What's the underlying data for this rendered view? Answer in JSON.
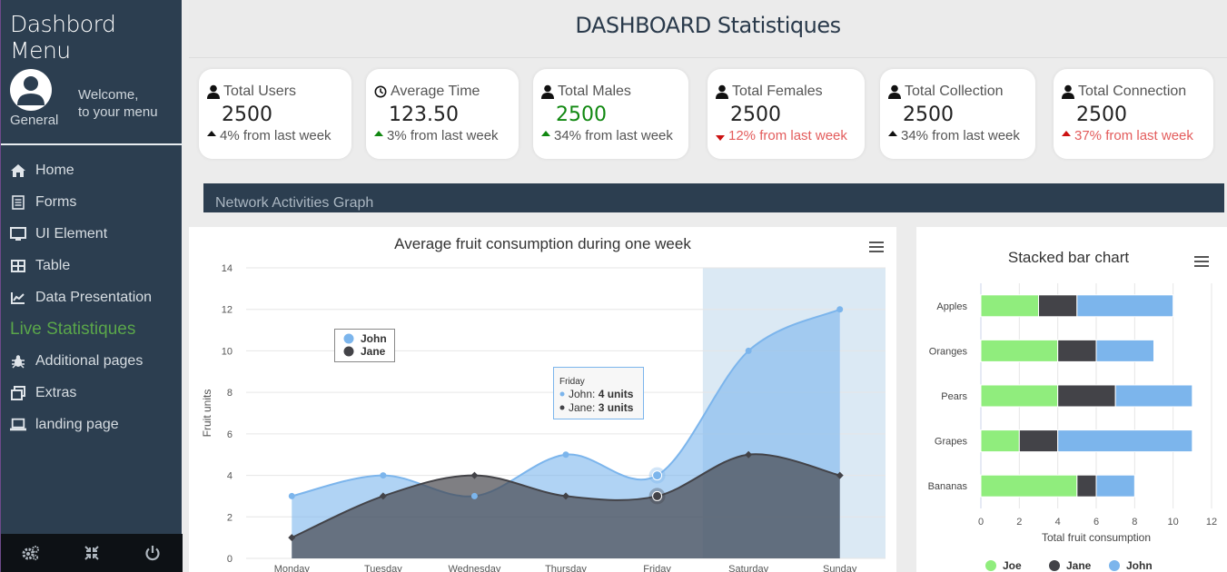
{
  "sidebar": {
    "title": "Dashbord Menu",
    "role": "General",
    "welcome_line1": "Welcome,",
    "welcome_line2": "to your menu",
    "items": [
      {
        "label": "Home",
        "icon": "home-icon"
      },
      {
        "label": "Forms",
        "icon": "form-icon"
      },
      {
        "label": "UI Element",
        "icon": "monitor-icon"
      },
      {
        "label": "Table",
        "icon": "table-icon"
      },
      {
        "label": "Data Presentation",
        "icon": "line-chart-icon"
      },
      {
        "label": "Live Statistiques",
        "icon": ""
      },
      {
        "label": "Additional pages",
        "icon": "bug-icon"
      },
      {
        "label": "Extras",
        "icon": "windows-icon"
      },
      {
        "label": "landing page",
        "icon": "laptop-icon"
      }
    ],
    "footer_icons": [
      "settings-icon",
      "compress-icon",
      "power-icon"
    ]
  },
  "header": {
    "title": "DASHBOARD Statistiques"
  },
  "cards": [
    {
      "title": "Total Users",
      "icon": "user-icon",
      "value": "2500",
      "change": "4% from last week",
      "trend": "up"
    },
    {
      "title": "Average Time",
      "icon": "clock-icon",
      "value": "123.50",
      "change": "3% from last week",
      "trend": "up-green"
    },
    {
      "title": "Total Males",
      "icon": "user-icon",
      "value": "2500",
      "change": "34% from last week",
      "trend": "up-green"
    },
    {
      "title": "Total Females",
      "icon": "user-icon",
      "value": "2500",
      "change": "12% from last week",
      "trend": "down"
    },
    {
      "title": "Total Collection",
      "icon": "user-icon",
      "value": "2500",
      "change": "34% from last week",
      "trend": "up"
    },
    {
      "title": "Total Connection",
      "icon": "user-icon",
      "value": "2500",
      "change": "37% from last week",
      "trend": "up-red"
    }
  ],
  "network": {
    "label": "Network Activities Graph"
  },
  "chart_data": [
    {
      "type": "area",
      "title": "Average fruit consumption during one week",
      "xlabel": "",
      "ylabel": "Fruit units",
      "categories": [
        "Monday",
        "Tuesday",
        "Wednesday",
        "Thursday",
        "Friday",
        "Saturday",
        "Sunday"
      ],
      "ylim": [
        0,
        14
      ],
      "yticks": [
        0,
        2,
        4,
        6,
        8,
        10,
        12,
        14
      ],
      "series": [
        {
          "name": "John",
          "values": [
            3,
            4,
            3,
            5,
            4,
            10,
            12
          ],
          "color": "#7cb5ec"
        },
        {
          "name": "Jane",
          "values": [
            1,
            3,
            4,
            3,
            3,
            5,
            4
          ],
          "color": "#434348"
        }
      ],
      "highlight_band": [
        "Saturday",
        "Sunday"
      ],
      "legend_position": "top-left",
      "tooltip": {
        "header": "Friday",
        "lines": [
          {
            "label": "John: ",
            "value": "4 units"
          },
          {
            "label": "Jane: ",
            "value": "3 units"
          }
        ]
      }
    },
    {
      "type": "bar",
      "orientation": "horizontal",
      "stacked": true,
      "title": "Stacked bar chart",
      "xlabel": "Total fruit consumption",
      "categories": [
        "Apples",
        "Oranges",
        "Pears",
        "Grapes",
        "Bananas"
      ],
      "xlim": [
        0,
        12
      ],
      "xticks": [
        0,
        2,
        4,
        6,
        8,
        10,
        12
      ],
      "series": [
        {
          "name": "Joe",
          "values": [
            3,
            4,
            4,
            2,
            5
          ],
          "color": "#90ed7d"
        },
        {
          "name": "Jane",
          "values": [
            2,
            2,
            3,
            2,
            1
          ],
          "color": "#434348"
        },
        {
          "name": "John",
          "values": [
            5,
            3,
            4,
            7,
            2
          ],
          "color": "#7cb5ec"
        }
      ],
      "legend_position": "bottom"
    }
  ]
}
